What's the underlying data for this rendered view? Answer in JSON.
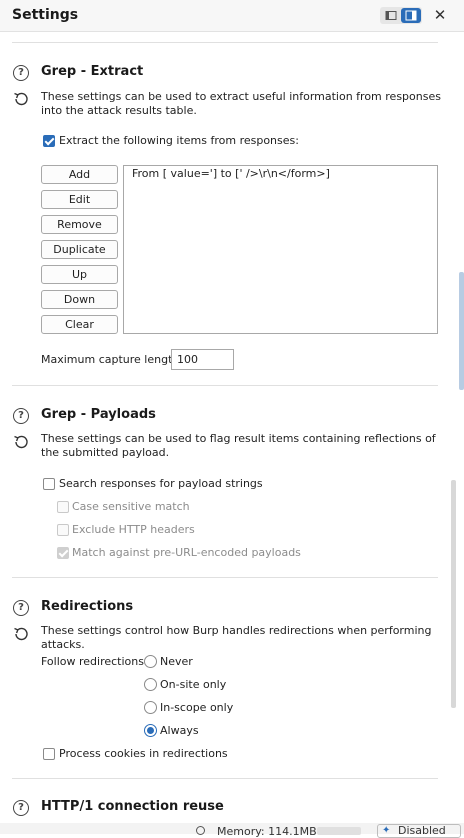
{
  "header": {
    "title": "Settings"
  },
  "grep_extract": {
    "title": "Grep - Extract",
    "description": "These settings can be used to extract useful information from responses into the attack results table.",
    "checkbox_label": "Extract the following items from responses:",
    "checkbox_checked": true,
    "buttons": [
      "Add",
      "Edit",
      "Remove",
      "Duplicate",
      "Up",
      "Down",
      "Clear"
    ],
    "items": [
      "From [ value='] to [' />\\r\\n</form>]"
    ],
    "max_capture_label": "Maximum capture length:",
    "max_capture_value": "100"
  },
  "grep_payloads": {
    "title": "Grep - Payloads",
    "description": "These settings can be used to flag result items containing reflections of the submitted payload.",
    "search_label": "Search responses for payload strings",
    "case_label": "Case sensitive match",
    "exclude_label": "Exclude HTTP headers",
    "match_label": "Match against pre-URL-encoded payloads"
  },
  "redirections": {
    "title": "Redirections",
    "description": "These settings control how Burp handles redirections when performing attacks.",
    "follow_label": "Follow redirections:",
    "options": [
      "Never",
      "On-site only",
      "In-scope only",
      "Always"
    ],
    "selected": "Always",
    "cookies_label": "Process cookies in redirections"
  },
  "http1": {
    "title": "HTTP/1 connection reuse"
  },
  "status_bar": {
    "memory": "Memory: 114.1MB",
    "disabled": "Disabled"
  },
  "colors": {
    "accent": "#2a6cb8"
  }
}
